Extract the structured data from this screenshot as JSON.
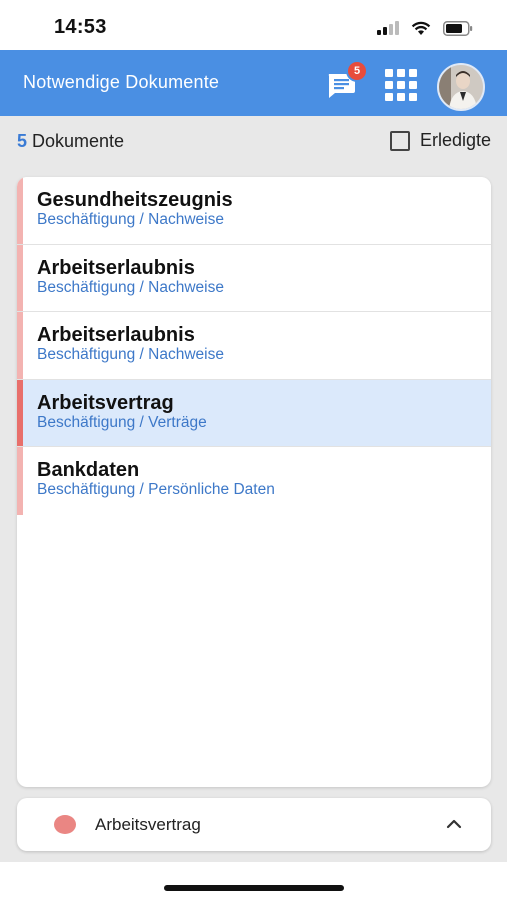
{
  "status_bar": {
    "time": "14:53"
  },
  "header": {
    "title": "Notwendige Dokumente",
    "chat_badge_count": "5",
    "accent_color": "#4a8fe3"
  },
  "summary": {
    "count": "5",
    "count_label": "Dokumente",
    "done_filter_label": "Erledigte",
    "done_filter_checked": false
  },
  "documents": [
    {
      "title": "Gesundheitszeugnis",
      "category": "Beschäftigung / Nachweise",
      "selected": false
    },
    {
      "title": "Arbeitserlaubnis",
      "category": "Beschäftigung / Nachweise",
      "selected": false
    },
    {
      "title": "Arbeitserlaubnis",
      "category": "Beschäftigung / Nachweise",
      "selected": false
    },
    {
      "title": "Arbeitsvertrag",
      "category": "Beschäftigung / Verträge",
      "selected": true
    },
    {
      "title": "Bankdaten",
      "category": "Beschäftigung / Persönliche Daten",
      "selected": false
    }
  ],
  "bottom_bar": {
    "label": "Arbeitsvertrag",
    "status_color": "#ea8683"
  },
  "icons": {
    "chat": "chat-bubble-icon",
    "apps": "apps-grid-icon",
    "chevron": "chevron-up-icon"
  }
}
